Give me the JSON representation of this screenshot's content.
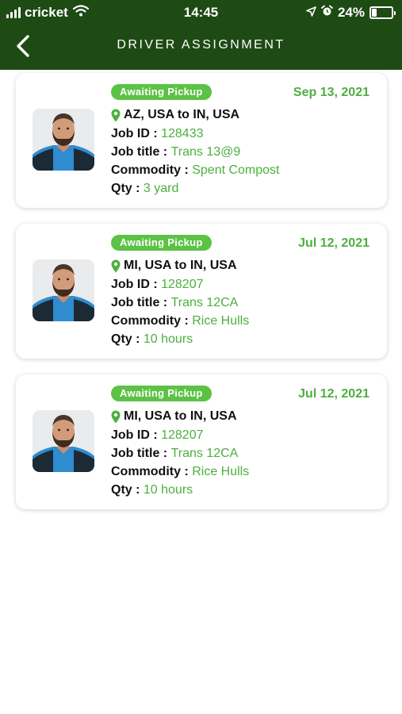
{
  "status_bar": {
    "carrier": "cricket",
    "time": "14:45",
    "battery_percent": "24%",
    "battery_level": 0.24,
    "icons": [
      "signal-bars-icon",
      "wifi-icon",
      "location-arrow-icon",
      "alarm-icon",
      "battery-icon"
    ]
  },
  "header": {
    "title": "DRIVER ASSIGNMENT",
    "back_icon": "chevron-left-icon",
    "background_color": "#1e4a14"
  },
  "labels": {
    "job_id": "Job ID : ",
    "job_title": "Job title : ",
    "commodity": "Commodity : ",
    "qty": "Qty : "
  },
  "colors": {
    "accent_green": "#4caf3e",
    "badge_green": "#5cc245"
  },
  "assignments": [
    {
      "status": "Awaiting Pickup",
      "date": "Sep 13, 2021",
      "route": "AZ, USA to IN, USA",
      "job_id": "128433",
      "job_title": "Trans 13@9",
      "commodity": "Spent Compost",
      "qty": "3 yard"
    },
    {
      "status": "Awaiting Pickup",
      "date": "Jul 12, 2021",
      "route": "MI, USA to IN, USA",
      "job_id": "128207",
      "job_title": "Trans 12CA",
      "commodity": "Rice Hulls",
      "qty": "10 hours"
    },
    {
      "status": "Awaiting Pickup",
      "date": "Jul 12, 2021",
      "route": "MI, USA to IN, USA",
      "job_id": "128207",
      "job_title": "Trans 12CA",
      "commodity": "Rice Hulls",
      "qty": "10 hours"
    }
  ]
}
